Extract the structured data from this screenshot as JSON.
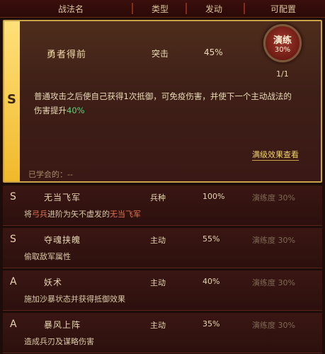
{
  "header": {
    "name": "战法名",
    "type": "类型",
    "rate": "发动",
    "config": "可配置"
  },
  "selected": {
    "grade": "S",
    "name": "勇者得前",
    "type": "突击",
    "rate": "45%",
    "badge_title": "演练",
    "badge_level": "30%",
    "count": "1/1",
    "desc_pre": "普通攻击之后使自己获得1次抵御，可免疫伤害，并使下一个主动战法的伤害提升",
    "desc_hl": "40%",
    "detail_link": "满级效果查看",
    "note": "已学会的：--"
  },
  "rows": [
    {
      "grade": "S",
      "name": "无当飞军",
      "type": "兵种",
      "rate": "100%",
      "level": "演练度 30%",
      "desc_pre": "将",
      "desc_hl1": "弓兵",
      "desc_mid": "进阶为矢不虚发的",
      "desc_hl2": "无当飞军"
    },
    {
      "grade": "S",
      "name": "夺魂挟魄",
      "type": "主动",
      "rate": "55%",
      "level": "演练度 30%",
      "desc": "偷取敌军属性"
    },
    {
      "grade": "A",
      "name": "妖术",
      "type": "主动",
      "rate": "40%",
      "level": "演练度 30%",
      "desc": "施加沙暴状态并获得抵御效果"
    },
    {
      "grade": "A",
      "name": "暴风上阵",
      "type": "主动",
      "rate": "35%",
      "level": "演练度 30%",
      "desc": "造成兵刃及谋略伤害"
    }
  ]
}
